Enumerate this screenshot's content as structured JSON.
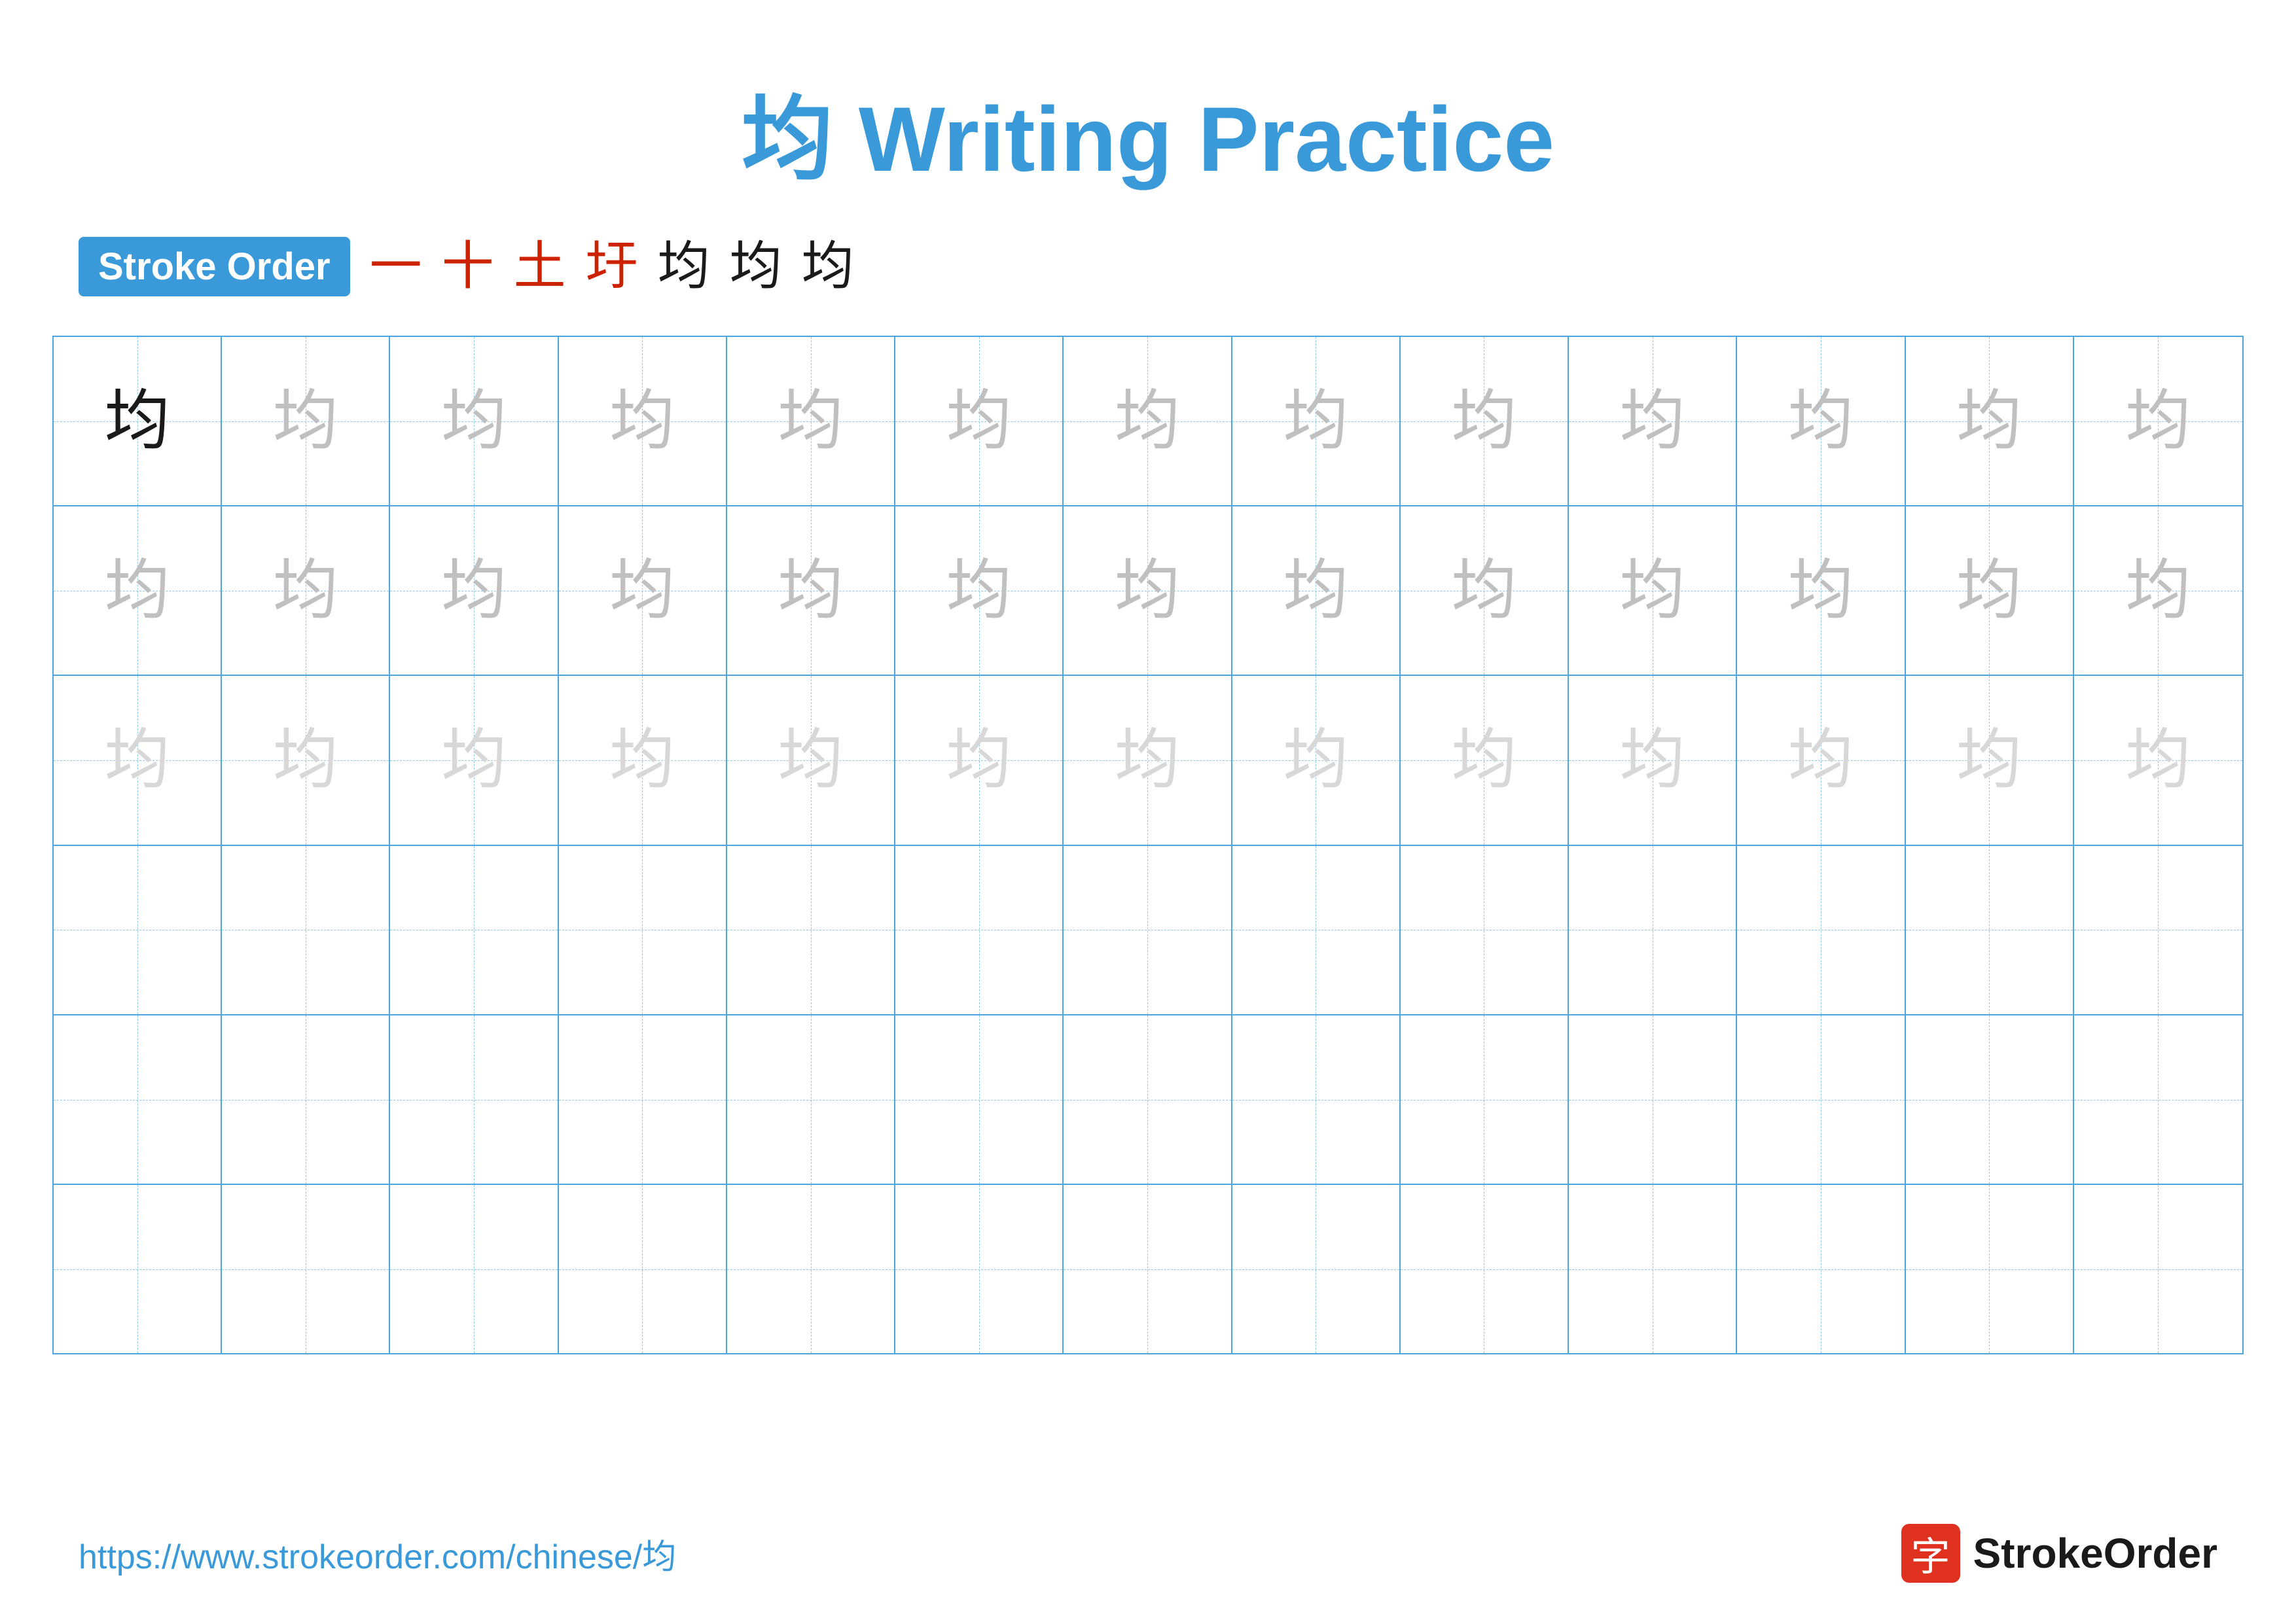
{
  "page": {
    "title_char": "均",
    "title_text": " Writing Practice",
    "stroke_order_label": "Stroke Order",
    "stroke_steps": [
      {
        "char": "一",
        "style": "red"
      },
      {
        "char": "十",
        "style": "red"
      },
      {
        "char": "土",
        "style": "red"
      },
      {
        "char": "圩",
        "style": "red"
      },
      {
        "char": "均",
        "style": "black"
      },
      {
        "char": "均",
        "style": "black"
      },
      {
        "char": "均",
        "style": "black"
      }
    ],
    "grid": {
      "rows": 6,
      "cols": 13,
      "char": "均",
      "row_configs": [
        {
          "type": "practice",
          "first_dark": true,
          "shade": "medium-gray"
        },
        {
          "type": "practice",
          "first_dark": false,
          "shade": "medium-gray"
        },
        {
          "type": "practice",
          "first_dark": false,
          "shade": "light-gray"
        },
        {
          "type": "empty"
        },
        {
          "type": "empty"
        },
        {
          "type": "empty"
        }
      ]
    },
    "footer": {
      "url": "https://www.strokeorder.com/chinese/均",
      "logo_char": "字",
      "logo_name": "StrokeOrder"
    }
  }
}
